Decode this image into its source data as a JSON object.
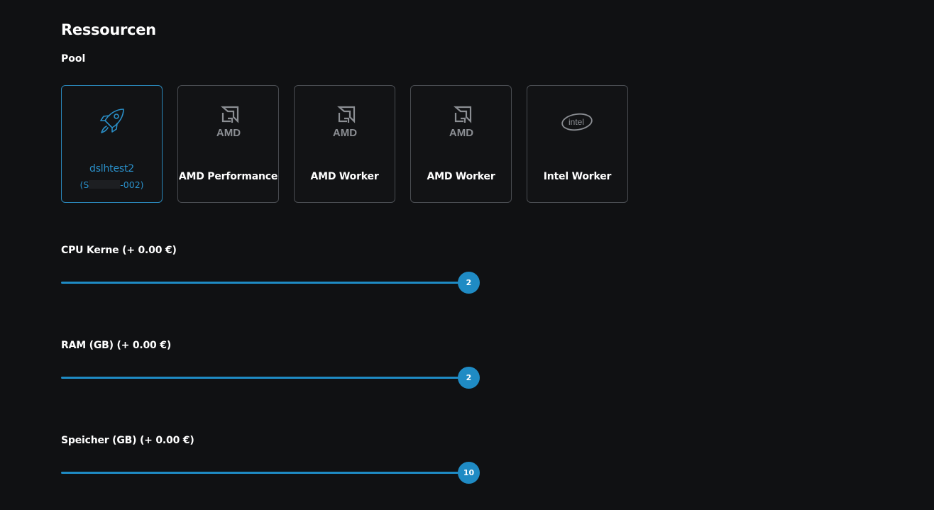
{
  "section": {
    "title": "Ressourcen",
    "pool_label": "Pool"
  },
  "pool": {
    "items": [
      {
        "title": "dslhtest2",
        "subtitle_prefix": "(S",
        "subtitle_suffix": "-002)",
        "icon": "rocket-icon",
        "selected": true
      },
      {
        "title": "AMD Performance",
        "icon": "amd-logo-icon",
        "logo_text": "AMD",
        "selected": false
      },
      {
        "title": "AMD Worker",
        "icon": "amd-logo-icon",
        "logo_text": "AMD",
        "selected": false
      },
      {
        "title": "AMD Worker",
        "icon": "amd-logo-icon",
        "logo_text": "AMD",
        "selected": false
      },
      {
        "title": "Intel Worker",
        "icon": "intel-logo-icon",
        "logo_text": "intel",
        "selected": false
      }
    ]
  },
  "sliders": {
    "cpu": {
      "label": "CPU Kerne (+ 0.00 €)",
      "value": "2"
    },
    "ram": {
      "label": "RAM (GB) (+ 0.00 €)",
      "value": "2"
    },
    "storage": {
      "label": "Speicher (GB) (+ 0.00 €)",
      "value": "10"
    }
  },
  "colors": {
    "background": "#101113",
    "accent": "#1f8bc4",
    "card_border": "#4a4d52"
  }
}
